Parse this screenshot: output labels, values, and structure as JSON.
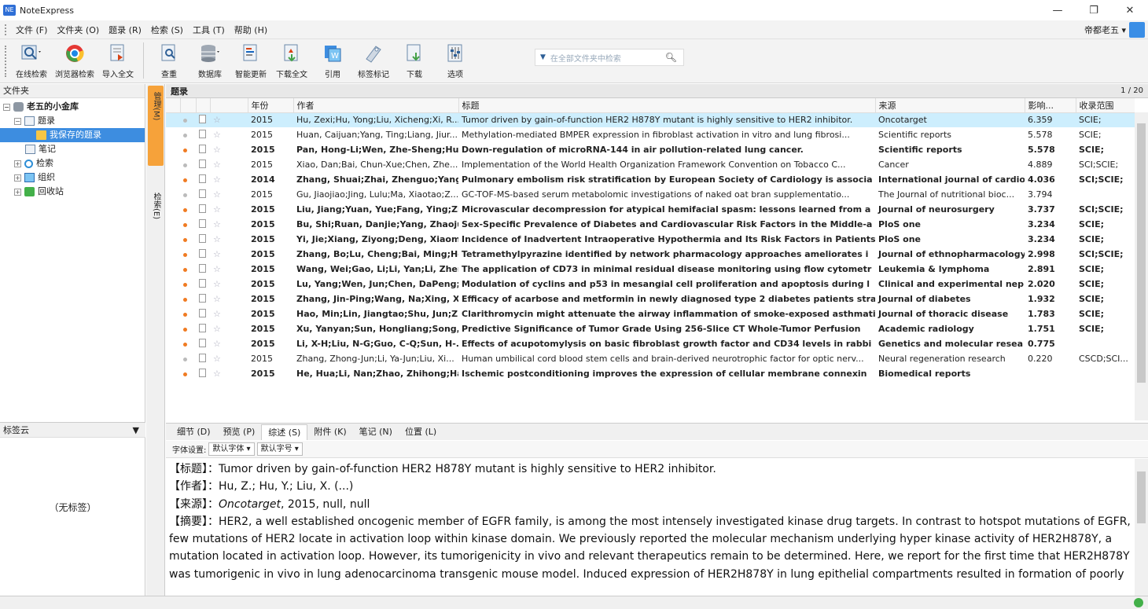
{
  "window": {
    "title": "NoteExpress",
    "logo": "NE"
  },
  "menu": {
    "items": [
      "文件 (F)",
      "文件夹 (O)",
      "题录 (R)",
      "检索 (S)",
      "工具 (T)",
      "帮助 (H)"
    ],
    "user": "帝都老五 ▾"
  },
  "toolbar": {
    "buttons": [
      "在线检索",
      "浏览器检索",
      "导入全文",
      "查重",
      "数据库",
      "智能更新",
      "下载全文",
      "引用",
      "标签标记",
      "下载",
      "选项"
    ],
    "search_placeholder": "在全部文件夹中检索"
  },
  "left": {
    "header": "文件夹",
    "tree": [
      {
        "label": "老五的小金库",
        "level": 0,
        "bold": true,
        "pm": "−"
      },
      {
        "label": "题录",
        "level": 1,
        "pm": "−"
      },
      {
        "label": "我保存的题录",
        "level": 2,
        "selected": true
      },
      {
        "label": "笔记",
        "level": 1
      },
      {
        "label": "检索",
        "level": 1,
        "pm": "+"
      },
      {
        "label": "组织",
        "level": 1,
        "pm": "+"
      },
      {
        "label": "回收站",
        "level": 1,
        "pm": "+"
      }
    ],
    "tagcloud_title": "标签云",
    "tagcloud_empty": "（无标签）"
  },
  "vtabs": {
    "manage": "管理",
    "manage_key": "(M)",
    "search": "检索",
    "search_key": "(E)"
  },
  "main": {
    "title": "题录",
    "page": "1 / 20",
    "columns": [
      "年份",
      "作者",
      "标题",
      "来源",
      "影响...",
      "收录范围"
    ],
    "rows": [
      {
        "year": "2015",
        "author": "Hu, Zexi;Hu, Yong;Liu, Xicheng;Xi, R...",
        "title": "Tumor driven by gain-of-function HER2 H878Y mutant is highly sensitive to HER2 inhibitor.",
        "source": "Oncotarget",
        "impact": "6.359",
        "scope": "SCIE;",
        "bold": false,
        "selected": true
      },
      {
        "year": "2015",
        "author": "Huan, Caijuan;Yang, Ting;Liang, Jiur...",
        "title": "Methylation-mediated BMPER expression in fibroblast activation in vitro and lung     fibrosi...",
        "source": "Scientific reports",
        "impact": "5.578",
        "scope": "SCIE;",
        "bold": false
      },
      {
        "year": "2015",
        "author": "Pan, Hong-Li;Wen, Zhe-Sheng;Hua",
        "title": "Down-regulation of microRNA-144 in air pollution-related lung cancer.",
        "source": "Scientific reports",
        "impact": "5.578",
        "scope": "SCIE;",
        "bold": true
      },
      {
        "year": "2015",
        "author": "Xiao, Dan;Bai, Chun-Xue;Chen, Zhe...",
        "title": "Implementation of the World Health Organization Framework Convention on Tobacco     C...",
        "source": "Cancer",
        "impact": "4.889",
        "scope": "SCI;SCIE;",
        "bold": false
      },
      {
        "year": "2014",
        "author": "Zhang, Shuai;Zhai, Zhenguo;Yang,",
        "title": "Pulmonary embolism risk stratification by European Society of Cardiology is     associa",
        "source": "International journal of cardio",
        "impact": "4.036",
        "scope": "SCI;SCIE;",
        "bold": true
      },
      {
        "year": "2015",
        "author": "Gu, Jiaojiao;Jing, Lulu;Ma, Xiaotao;Z...",
        "title": "GC-TOF-MS-based serum metabolomic investigations of naked oat bran     supplementatio...",
        "source": "The Journal of nutritional bioc...",
        "impact": "3.794",
        "scope": "",
        "bold": false
      },
      {
        "year": "2015",
        "author": "Liu, Jiang;Yuan, Yue;Fang, Ying;Zha",
        "title": "Microvascular decompression for atypical hemifacial spasm: lessons learned from a",
        "source": "Journal of neurosurgery",
        "impact": "3.737",
        "scope": "SCI;SCIE;",
        "bold": true
      },
      {
        "year": "2015",
        "author": "Bu, Shi;Ruan, Danjie;Yang, Zhaojun",
        "title": "Sex-Specific Prevalence of Diabetes and Cardiovascular Risk Factors in the     Middle-a",
        "source": "PloS one",
        "impact": "3.234",
        "scope": "SCIE;",
        "bold": true
      },
      {
        "year": "2015",
        "author": "Yi, Jie;Xiang, Ziyong;Deng, Xiaomi",
        "title": "Incidence of Inadvertent Intraoperative Hypothermia and Its Risk Factors in     Patients",
        "source": "PloS one",
        "impact": "3.234",
        "scope": "SCIE;",
        "bold": true
      },
      {
        "year": "2015",
        "author": "Zhang, Bo;Lu, Cheng;Bai, Ming;He",
        "title": "Tetramethylpyrazine identified by network pharmacology approaches ameliorates     i",
        "source": "Journal of ethnopharmacology",
        "impact": "2.998",
        "scope": "SCI;SCIE;",
        "bold": true
      },
      {
        "year": "2015",
        "author": "Wang, Wei;Gao, Li;Li, Yan;Li, Zhen",
        "title": "The application of CD73 in minimal residual disease monitoring using flow     cytometr",
        "source": "Leukemia & lymphoma",
        "impact": "2.891",
        "scope": "SCIE;",
        "bold": true
      },
      {
        "year": "2015",
        "author": "Lu, Yang;Wen, Jun;Chen, DaPeng;.",
        "title": "Modulation of cyclins and p53 in mesangial cell proliferation and apoptosis     during l",
        "source": "Clinical and experimental nep",
        "impact": "2.020",
        "scope": "SCIE;",
        "bold": true
      },
      {
        "year": "2015",
        "author": "Zhang, Jin-Ping;Wang, Na;Xing, Xi",
        "title": "Efficacy of acarbose and metformin in newly diagnosed type 2 diabetes patients     stra",
        "source": "Journal of diabetes",
        "impact": "1.932",
        "scope": "SCIE;",
        "bold": true
      },
      {
        "year": "2015",
        "author": "Hao, Min;Lin, Jiangtao;Shu, Jun;Zh",
        "title": "Clarithromycin might attenuate the airway inflammation of smoke-exposed asthmatic",
        "source": "Journal of thoracic disease",
        "impact": "1.783",
        "scope": "SCIE;",
        "bold": true
      },
      {
        "year": "2015",
        "author": "Xu, Yanyan;Sun, Hongliang;Song, ,",
        "title": "Predictive Significance of Tumor Grade Using 256-Slice CT Whole-Tumor Perfusion",
        "source": "Academic radiology",
        "impact": "1.751",
        "scope": "SCIE;",
        "bold": true
      },
      {
        "year": "2015",
        "author": "Li, X-H;Liu, N-G;Guo, C-Q;Sun, H-.",
        "title": "Effects of acupotomylysis on basic fibroblast growth factor and CD34 levels in     rabbi",
        "source": "Genetics and molecular resea",
        "impact": "0.775",
        "scope": "",
        "bold": true
      },
      {
        "year": "2015",
        "author": "Zhang, Zhong-Jun;Li, Ya-Jun;Liu, Xi...",
        "title": "Human umbilical cord blood stem cells and brain-derived neurotrophic factor for optic nerv...",
        "source": "Neural regeneration research",
        "impact": "0.220",
        "scope": "CSCD;SCI...",
        "bold": false
      },
      {
        "year": "2015",
        "author": "He, Hua;Li, Nan;Zhao, Zhihong;Ha",
        "title": "Ischemic postconditioning improves the expression of cellular membrane connexin",
        "source": "Biomedical reports",
        "impact": "",
        "scope": "",
        "bold": true
      }
    ]
  },
  "tabs": [
    "细节 (D)",
    "预览 (P)",
    "综述 (S)",
    "附件 (K)",
    "笔记 (N)",
    "位置 (L)"
  ],
  "fontbar": {
    "label": "字体设置:",
    "font": "默认字体",
    "size": "默认字号"
  },
  "detail": {
    "title_label": "【标题】",
    "title_value": "：Tumor driven by gain-of-function HER2 H878Y mutant is highly sensitive to HER2 inhibitor.",
    "author_label": "【作者】",
    "author_value": "：Hu, Z.; Hu, Y.; Liu, X. (...)",
    "source_label": "【来源】",
    "source_journal": "Oncotarget",
    "source_rest": ", 2015, null, null",
    "abstract_label": "【摘要】",
    "abstract_value": "：HER2, a well established oncogenic member of EGFR family, is among the most intensely investigated kinase drug targets. In contrast to hotspot mutations of EGFR, few mutations of HER2 locate in activation loop within kinase domain. We previously reported the molecular mechanism underlying hyper kinase activity of HER2H878Y, a mutation located in activation loop. However, its tumorigenicity in vivo and relevant therapeutics remain to be determined. Here, we report for the first time that HER2H878Y was tumorigenic in vivo in lung adenocarcinoma transgenic mouse model. Induced expression of HER2H878Y in lung epithelial compartments resulted in formation of poorly"
  }
}
